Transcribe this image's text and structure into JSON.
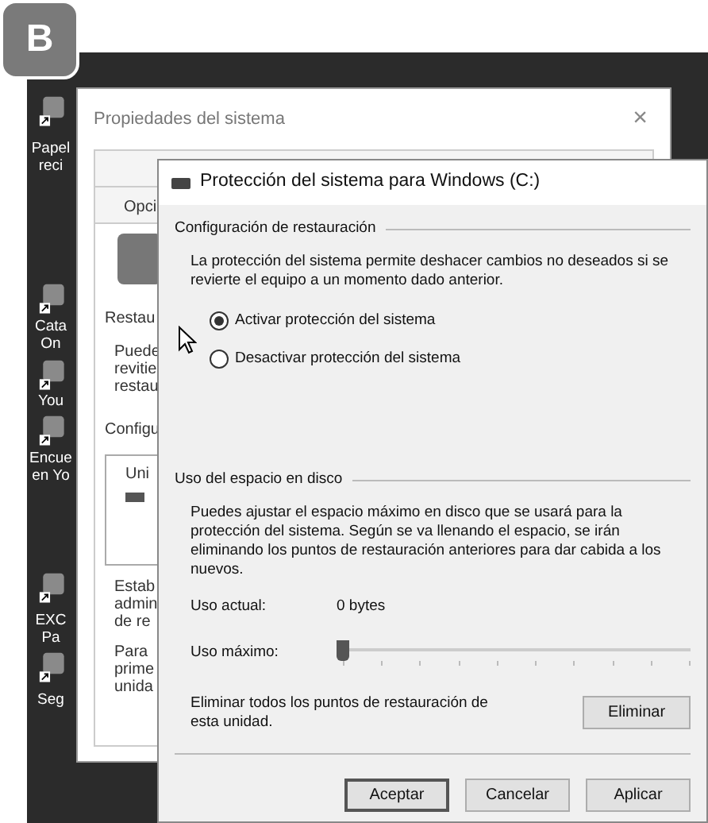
{
  "badge": "B",
  "desktop_icons": [
    {
      "label": [
        "Papel",
        "reci"
      ]
    },
    {
      "label": [
        "Cata",
        "On"
      ]
    },
    {
      "label": [
        "You"
      ]
    },
    {
      "label": [
        "Encue",
        "en Yo"
      ]
    },
    {
      "label": [
        "EXC",
        "Pa"
      ]
    },
    {
      "label": [
        "Seg"
      ]
    }
  ],
  "back_window": {
    "title": "Propiedades del sistema",
    "close": "×",
    "tab": "Opci",
    "texts": [
      {
        "kind": "heading",
        "lines": [
          "Restau"
        ]
      },
      {
        "kind": "para",
        "lines": [
          "Puede",
          "revitie",
          "restau"
        ]
      },
      {
        "kind": "heading",
        "lines": [
          "Configu"
        ]
      },
      {
        "kind": "list",
        "lines": [
          "Uni"
        ]
      },
      {
        "kind": "para",
        "lines": [
          "Estab",
          "admin",
          "de re"
        ]
      },
      {
        "kind": "para",
        "lines": [
          "Para",
          "prime",
          "unida"
        ]
      }
    ]
  },
  "dialog": {
    "title": "Protección del sistema para Windows (C:)",
    "restore_group": {
      "title": "Configuración de restauración",
      "text": "La protección del sistema permite deshacer cambios no deseados si se revierte el equipo a un momento dado anterior.",
      "options": [
        {
          "label": "Activar protección del sistema",
          "selected": true
        },
        {
          "label": "Desactivar protección del sistema",
          "selected": false
        }
      ]
    },
    "disk_group": {
      "title": "Uso del espacio en disco",
      "text": "Puedes ajustar el espacio máximo en disco que se usará para la protección del sistema. Según se va llenando el espacio, se irán eliminando los puntos de restauración anteriores para dar cabida a los nuevos.",
      "current_label": "Uso actual:",
      "current_value": "0 bytes",
      "max_label": "Uso máximo:",
      "max_slider": {
        "level": 0
      },
      "delete_text": "Eliminar todos los puntos de restauración de esta unidad.",
      "delete_button": "Eliminar"
    },
    "buttons": [
      {
        "label": "Aceptar",
        "default": true
      },
      {
        "label": "Cancelar",
        "default": false
      },
      {
        "label": "Aplicar",
        "default": false
      }
    ]
  }
}
